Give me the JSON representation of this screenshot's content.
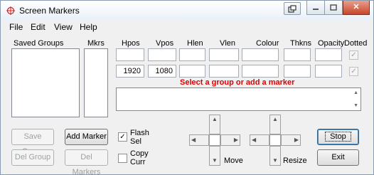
{
  "window": {
    "title": "Screen Markers"
  },
  "menu": [
    "File",
    "Edit",
    "View",
    "Help"
  ],
  "lists": {
    "saved_groups_label": "Saved Groups",
    "mkrs_label": "Mkrs"
  },
  "columns": {
    "hpos": "Hpos",
    "vpos": "Vpos",
    "hlen": "Hlen",
    "vlen": "Vlen",
    "colour": "Colour",
    "thkns": "Thkns",
    "opacity": "Opacity",
    "dotted": "Dotted"
  },
  "row1": {
    "hpos": "",
    "vpos": "",
    "hlen": "",
    "vlen": "",
    "colour": "",
    "thkns": "",
    "opacity": ""
  },
  "row2": {
    "hpos": "1920",
    "vpos": "1080",
    "hlen": "",
    "vlen": "",
    "colour": "",
    "thkns": "",
    "opacity": ""
  },
  "status_text": "Select a group or add a marker",
  "buttons": {
    "save_group": "Save Group",
    "add_marker": "Add Marker",
    "del_group": "Del Group",
    "del_markers": "Del Markers",
    "stop": "Stop",
    "exit": "Exit"
  },
  "checks": {
    "flash_sel": "Flash\nSel",
    "copy_curr": "Copy\nCurr",
    "flash_checked": true,
    "copy_checked": false
  },
  "pads": {
    "move": "Move",
    "resize": "Resize"
  },
  "glyphs": {
    "check": "✓",
    "up": "▲",
    "down": "▼",
    "left": "◀",
    "right": "▶",
    "close": "✕"
  },
  "colors": {
    "status": "#e00000",
    "close_button": "#c9462c"
  }
}
